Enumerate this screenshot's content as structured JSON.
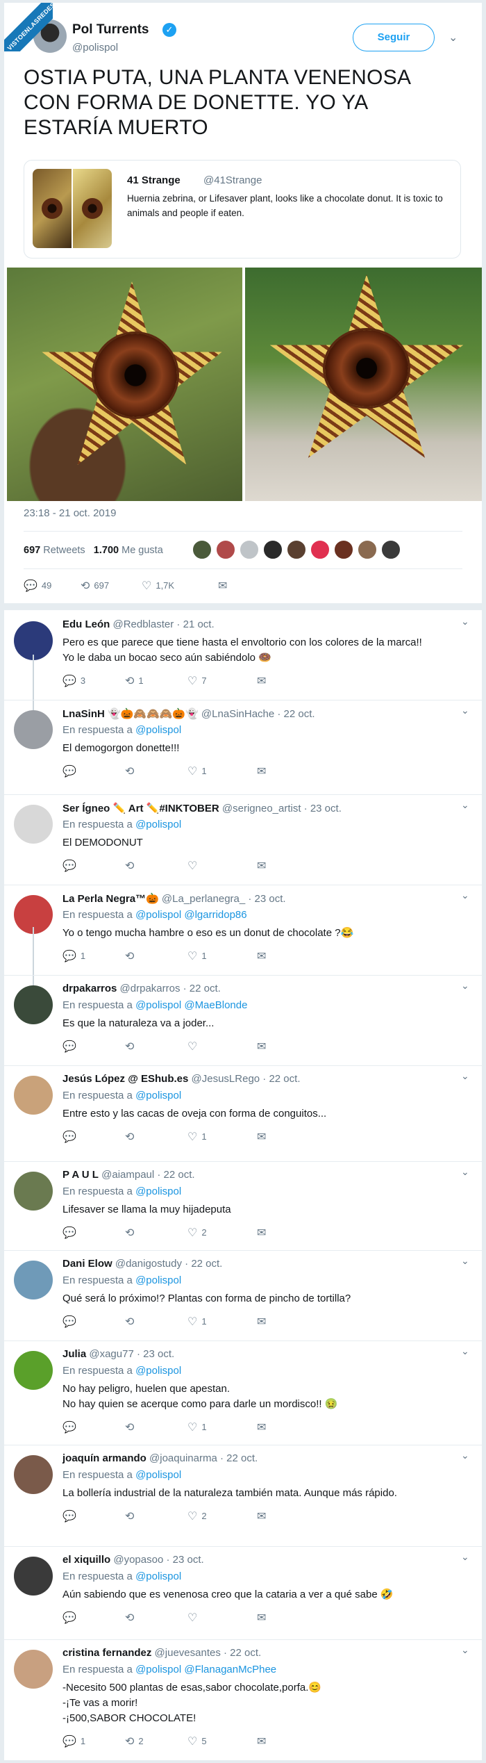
{
  "watermark": {
    "text": "VISTOENLASREDES"
  },
  "tweet": {
    "author": "Pol Turrents",
    "verified": "✓",
    "handle": "@polispol",
    "follow": "Seguir",
    "text": "OSTIA PUTA, UNA PLANTA VENENOSA CON FORMA DE DONETTE. YO YA ESTARÍA MUERTO",
    "quote": {
      "author": "41 Strange",
      "handle": "@41Strange",
      "text": "Huernia zebrina, or Lifesaver plant, looks like a chocolate donut. It is toxic to animals and people if eaten."
    },
    "timestamp": "23:18 - 21 oct. 2019",
    "retweets_count": "697",
    "retweets_label": "Retweets",
    "likes_count": "1.700",
    "likes_label": "Me gusta",
    "replies": "49",
    "rts": "697",
    "favs": "1,7K"
  },
  "icons": {
    "reply": "reply-icon",
    "retweet": "retweet-icon",
    "like": "heart-icon",
    "dm": "envelope-icon",
    "caret": "chevron-down-icon"
  },
  "replies": [
    {
      "name": "Edu León",
      "handle": "@Redblaster",
      "date": "· 21 oct.",
      "to": "",
      "text": "Pero es que parece que tiene hasta el envoltorio con los colores de la marca!!\nYo le daba un bocao seco aún sabiéndolo 🍩",
      "r": "3",
      "rt": "1",
      "l": "7",
      "color": "#2b3a7a"
    },
    {
      "name": "LnaSinH 👻🎃🙈🙈🙈🎃👻",
      "handle": "@LnaSinHache",
      "date": "· 22 oct.",
      "to": "@polispol",
      "text": "El demogorgon donette!!!",
      "r": "",
      "rt": "",
      "l": "1",
      "color": "#9a9ea4"
    },
    {
      "name": "Ser Ígneo ✏️ Art ✏️#INKTOBER",
      "handle": "@serigneo_artist",
      "date": "· 23 oct.",
      "to": "@polispol",
      "text": "El DEMODONUT",
      "r": "",
      "rt": "",
      "l": "",
      "color": "#d8d8d8"
    },
    {
      "name": "La Perla Negra™🎃",
      "handle": "@La_perlanegra_",
      "date": "· 23 oct.",
      "to": "@polispol @lgarridop86",
      "text": "Yo o tengo mucha hambre o eso es un donut de chocolate ?😂",
      "r": "1",
      "rt": "",
      "l": "1",
      "color": "#c84040"
    },
    {
      "name": "drpakarros",
      "handle": "@drpakarros",
      "date": "· 22 oct.",
      "to": "@polispol @MaeBlonde",
      "text": "Es que la naturaleza va a joder...",
      "r": "",
      "rt": "",
      "l": "",
      "color": "#3a4a3a"
    },
    {
      "name": "Jesús López @ EShub.es",
      "handle": "@JesusLRego",
      "date": "· 22 oct.",
      "to": "@polispol",
      "text": "Entre esto y las cacas de oveja con forma de conguitos...",
      "r": "",
      "rt": "",
      "l": "1",
      "color": "#c9a27a"
    },
    {
      "name": "P A U L",
      "handle": "@aiampaul",
      "date": "· 22 oct.",
      "to": "@polispol",
      "text": "Lifesaver se llama la muy hijadeputa",
      "r": "",
      "rt": "",
      "l": "2",
      "color": "#6a7a50"
    },
    {
      "name": "Dani Elow",
      "handle": "@danigostudy",
      "date": "· 22 oct.",
      "to": "@polispol",
      "text": "Qué será lo próximo!? Plantas con forma de pincho de tortilla?",
      "r": "",
      "rt": "",
      "l": "1",
      "color": "#6f9ab8"
    },
    {
      "name": "Julia",
      "handle": "@xagu77",
      "date": "· 23 oct.",
      "to": "@polispol",
      "text": "No hay peligro, huelen que apestan.\nNo hay quien se acerque como para darle un mordisco!! 🤢",
      "r": "",
      "rt": "",
      "l": "1",
      "color": "#5aa02a"
    },
    {
      "name": "joaquín armando",
      "handle": "@joaquinarma",
      "date": "· 22 oct.",
      "to": "@polispol",
      "text": "La bollería industrial de la naturaleza también mata. Aunque más rápido.",
      "r": "",
      "rt": "",
      "l": "2",
      "color": "#7a5a4a"
    },
    {
      "name": "el xiquillo",
      "handle": "@yopasoo",
      "date": "· 23 oct.",
      "to": "@polispol",
      "text": "Aún sabiendo que es venenosa creo que la cataria a ver a qué sabe 🤣",
      "r": "",
      "rt": "",
      "l": "",
      "color": "#3a3a3a"
    },
    {
      "name": "cristina fernandez",
      "handle": "@juevesantes",
      "date": "· 22 oct.",
      "to": "@polispol @FlanaganMcPhee",
      "text": "-Necesito 500 plantas de esas,sabor chocolate,porfa.😊\n-¡Te vas a morir!\n-¡500,SABOR CHOCOLATE!",
      "r": "1",
      "rt": "2",
      "l": "5",
      "color": "#c8a080"
    }
  ],
  "reply_prefix": "En respuesta a"
}
